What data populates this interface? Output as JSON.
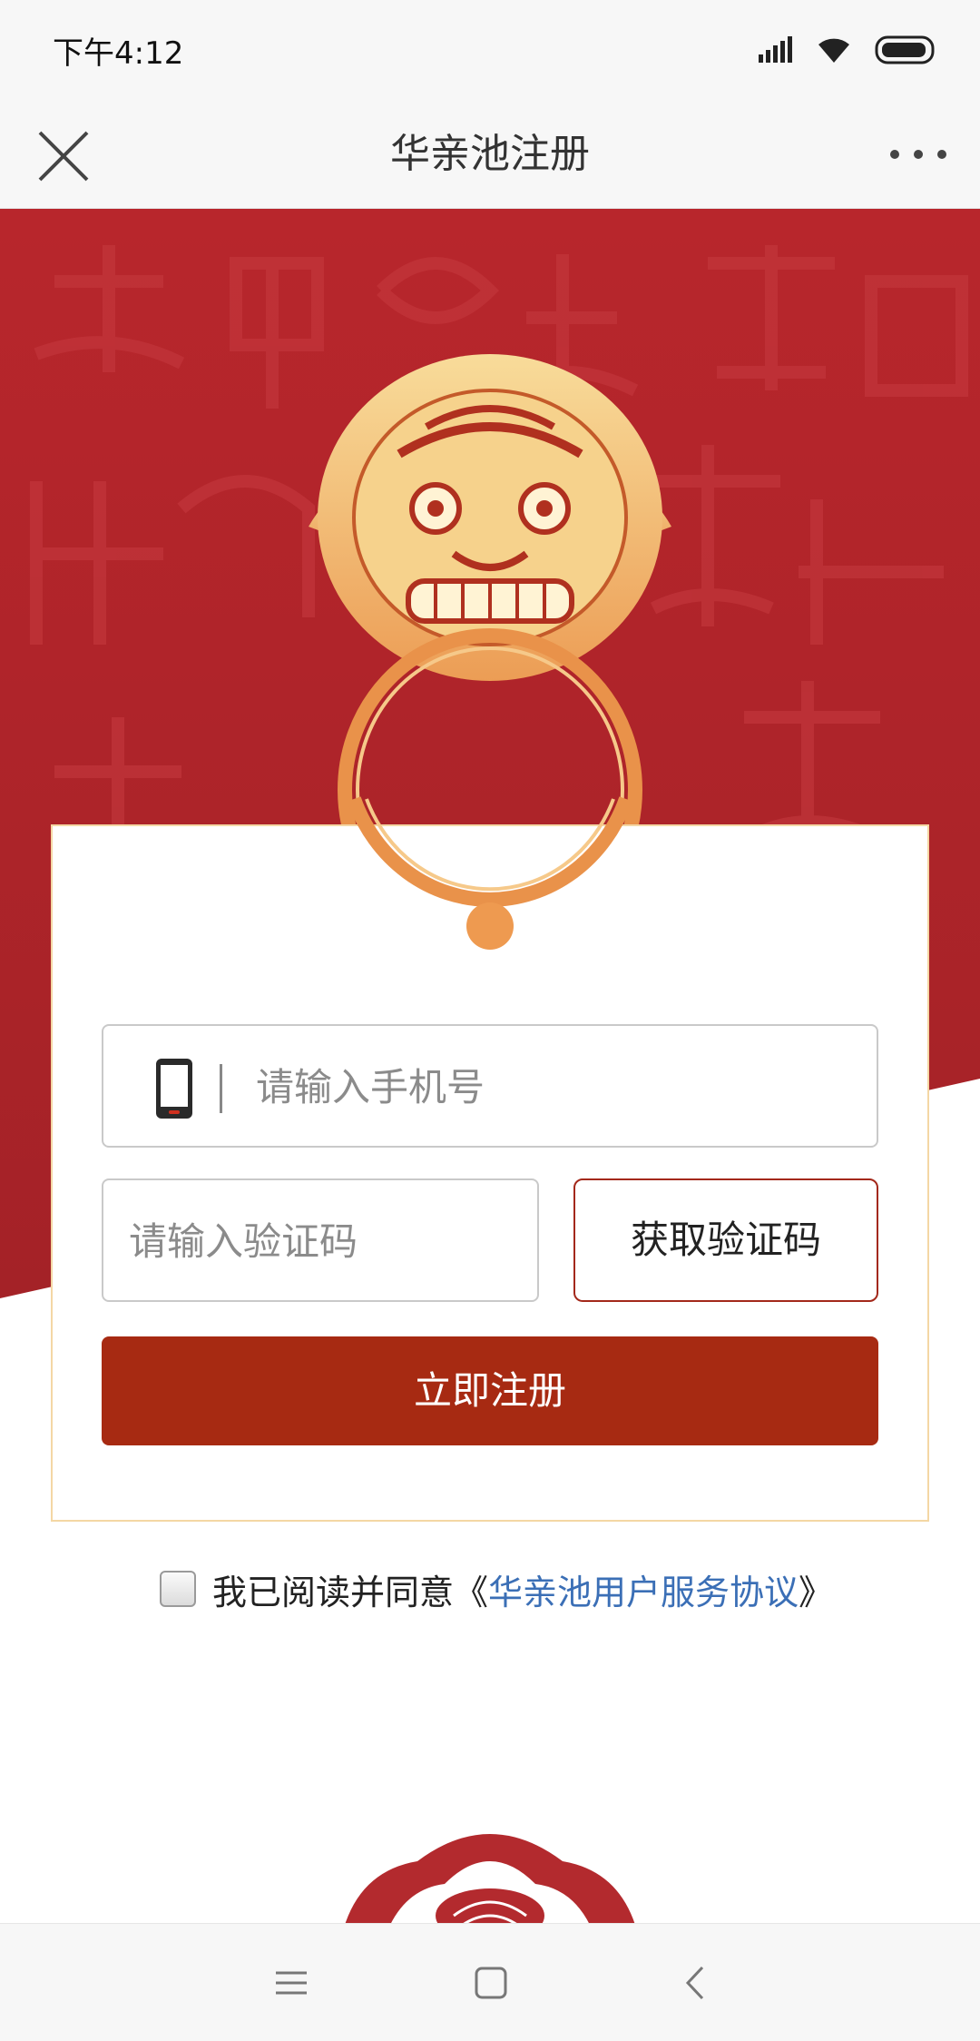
{
  "status_bar": {
    "time": "下午4:12",
    "icons": [
      "signal-icon",
      "wifi-icon",
      "battery-icon"
    ]
  },
  "nav": {
    "title": "华亲池注册",
    "close_icon": "close-icon",
    "more_icon": "more-icon"
  },
  "form": {
    "phone_placeholder": "请输入手机号",
    "code_placeholder": "请输入验证码",
    "get_code_label": "获取验证码",
    "register_label": "立即注册"
  },
  "agreement": {
    "prefix": "我已阅读并同意《",
    "link": "华亲池用户服务协议",
    "suffix": "》",
    "checked": false
  },
  "colors": {
    "brand_red": "#a72a12",
    "hero_red": "#b32a2e",
    "gold": "#f3c57c",
    "link_blue": "#3b6fb6"
  },
  "system_nav": {
    "icons": [
      "menu-icon",
      "home-icon",
      "back-icon"
    ]
  }
}
